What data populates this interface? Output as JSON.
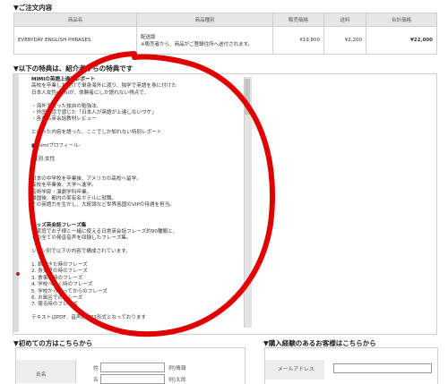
{
  "order_section": {
    "title": "▼ご注文内容",
    "headers": [
      "商品名",
      "商品種別",
      "販売価格",
      "送料",
      "合計価格"
    ],
    "row": {
      "product": "EVERYDAY ENGLISH PHRASES",
      "type_line1": "配送版",
      "type_line2": "※販売者から、商品がご登録住所へ送付されます。",
      "price": "¥19,800",
      "shipping": "¥2,200",
      "total": "¥22,000"
    }
  },
  "bonus_section": {
    "title": "▼以下の特典は、紹介者からの特典です",
    "lines": [
      {
        "text": "MIMIの英語上達法レポート",
        "bold": true
      },
      {
        "text": "高校を卒業しただけで単身海外に渡り、独学で英語を身に付けた"
      },
      {
        "text": "日本人女性mimiが、体験者にしか語れない視点で、"
      },
      {
        "text": ""
      },
      {
        "text": "・海外で行った独自の勉強法、"
      },
      {
        "text": "・外国生活で感じた「日本人が英語が上達しないワケ」"
      },
      {
        "text": "・各有名英会話教材レビュー"
      },
      {
        "text": ""
      },
      {
        "text": "といった内容を語った、ここでしか知れない特別レポート"
      },
      {
        "text": ""
      },
      {
        "text": "■mimiプロフィール-"
      },
      {
        "text": ""
      },
      {
        "text": "-性別:女性"
      },
      {
        "text": ""
      },
      {
        "text": ""
      },
      {
        "text": "日本の中学校を卒業後、アメリカの高校へ留学。"
      },
      {
        "text": "高校を卒業後、大学へ進学。"
      },
      {
        "text": "芸術学部・演劇学科卒業。"
      },
      {
        "text": "帰国後、都内の某有名ホテルに就職。"
      },
      {
        "text": "その英語力を生かし、大統領など世界各国のVIPの待遇を担当。"
      },
      {
        "text": ""
      },
      {
        "text": ""
      },
      {
        "text": "キッズ英会話フレーズ集",
        "bold": true
      },
      {
        "text": "ご家庭でお子様と一緒に使える日常英会話フレーズ約90種類と、"
      },
      {
        "text": "その全ての発音音声を収録したフレーズ集。"
      },
      {
        "text": ""
      },
      {
        "text": "シーン別で以下の内容で構成されています。"
      },
      {
        "text": ""
      },
      {
        "text": "1. 朝起きた時のフレーズ"
      },
      {
        "text": "2. 身支度の時のフレーズ"
      },
      {
        "text": "3. 食事の時のフレーズ"
      },
      {
        "text": "4. 学校へ行く時のフレーズ"
      },
      {
        "text": "5. 学校から帰ってからのフレーズ"
      },
      {
        "text": "6. お風呂でのフレーズ"
      },
      {
        "text": "7. 寝る時のフレーズ"
      },
      {
        "text": ""
      },
      {
        "text": "テキストはPDF、音声はMP3形式となっております"
      }
    ]
  },
  "first_time": {
    "title": "▼初めての方はこちらから",
    "name_label": "氏名",
    "sei_label": "姓",
    "mei_label": "名",
    "example1": "例)情報",
    "example2": "例)太郎"
  },
  "returning": {
    "title": "▼購入経験のあるお客様はこちらから",
    "email_label": "メールアドレス"
  },
  "annotation_color": "#e00000"
}
